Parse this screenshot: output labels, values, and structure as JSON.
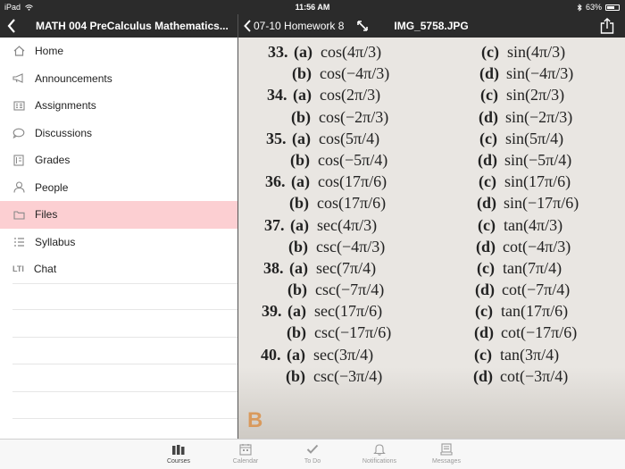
{
  "status_bar": {
    "device": "iPad",
    "time": "11:56 AM",
    "battery": "63%",
    "battery_fraction": 0.63
  },
  "left_header": {
    "course_title": "MATH 004 PreCalculus Mathematics..."
  },
  "right_header": {
    "back_label": "07-10 Homework 8",
    "file_name": "IMG_5758.JPG"
  },
  "sidebar": {
    "items": [
      {
        "label": "Home",
        "icon": "home-icon"
      },
      {
        "label": "Announcements",
        "icon": "megaphone-icon"
      },
      {
        "label": "Assignments",
        "icon": "assignment-icon"
      },
      {
        "label": "Discussions",
        "icon": "chat-bubble-icon"
      },
      {
        "label": "Grades",
        "icon": "gradebook-icon"
      },
      {
        "label": "People",
        "icon": "person-icon"
      },
      {
        "label": "Files",
        "icon": "folder-icon",
        "active": true
      },
      {
        "label": "Syllabus",
        "icon": "list-icon"
      },
      {
        "label": "Chat",
        "icon": "lti-icon",
        "icon_text": "LTI"
      }
    ]
  },
  "photo": {
    "rows": [
      {
        "num": "33.",
        "a": "cos(4π/3)",
        "c": "sin(4π/3)"
      },
      {
        "b": "cos(−4π/3)",
        "d": "sin(−4π/3)"
      },
      {
        "num": "34.",
        "a": "cos(2π/3)",
        "c": "sin(2π/3)"
      },
      {
        "b": "cos(−2π/3)",
        "d": "sin(−2π/3)"
      },
      {
        "num": "35.",
        "a": "cos(5π/4)",
        "c": "sin(5π/4)"
      },
      {
        "b": "cos(−5π/4)",
        "d": "sin(−5π/4)"
      },
      {
        "num": "36.",
        "a": "cos(17π/6)",
        "c": "sin(17π/6)"
      },
      {
        "b": "cos(17π/6)",
        "d": "sin(−17π/6)"
      },
      {
        "num": "37.",
        "a": "sec(4π/3)",
        "c": "tan(4π/3)"
      },
      {
        "b": "csc(−4π/3)",
        "d": "cot(−4π/3)"
      },
      {
        "num": "38.",
        "a": "sec(7π/4)",
        "c": "tan(7π/4)"
      },
      {
        "b": "csc(−7π/4)",
        "d": "cot(−7π/4)"
      },
      {
        "num": "39.",
        "a": "sec(17π/6)",
        "c": "tan(17π/6)"
      },
      {
        "b": "csc(−17π/6)",
        "d": "cot(−17π/6)"
      },
      {
        "num": "40.",
        "a": "sec(3π/4)",
        "c": "tan(3π/4)"
      },
      {
        "b": "csc(−3π/4)",
        "d": "cot(−3π/4)"
      }
    ],
    "part_labels": {
      "a": "(a)",
      "b": "(b)",
      "c": "(c)",
      "d": "(d)"
    },
    "corner_mark": "B"
  },
  "tab_bar": {
    "tabs": [
      {
        "label": "Courses",
        "icon": "courses-icon",
        "active": true
      },
      {
        "label": "Calendar",
        "icon": "calendar-icon"
      },
      {
        "label": "To Do",
        "icon": "checkmark-icon"
      },
      {
        "label": "Notifications",
        "icon": "bell-icon"
      },
      {
        "label": "Messages",
        "icon": "inbox-icon"
      }
    ]
  }
}
